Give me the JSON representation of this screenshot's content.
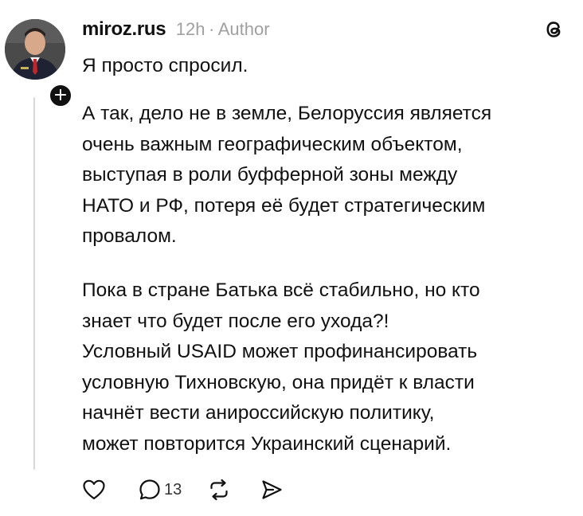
{
  "post": {
    "username": "miroz.rus",
    "time": "12h",
    "separator": "·",
    "author_label": "Author",
    "follow_glyph": "+",
    "first_line": "Я просто спросил.",
    "paragraph2": [
      "А так, дело не в земле, Белоруссия является",
      "очень важным географическим объектом,",
      "выступая в роли буфферной зоны между",
      "НАТО и РФ, потеря её будет стратегическим",
      "провалом."
    ],
    "paragraph3": [
      "Пока в стране Батька всё стабильно, но кто",
      "знает что будет после его ухода?!",
      "Условный USAID может профинансировать",
      "условную Тихновскую, она придёт к власти",
      "начнёт вести анироссийскую политику,",
      "может повторится Украинский сценарий."
    ]
  },
  "actions": {
    "like_icon": "heart-icon",
    "reply_icon": "comment-icon",
    "reply_count": "13",
    "repost_icon": "repost-icon",
    "share_icon": "send-icon"
  },
  "colors": {
    "text": "#111111",
    "muted": "#a0a0a0",
    "thread_line": "#d9d9d9"
  }
}
